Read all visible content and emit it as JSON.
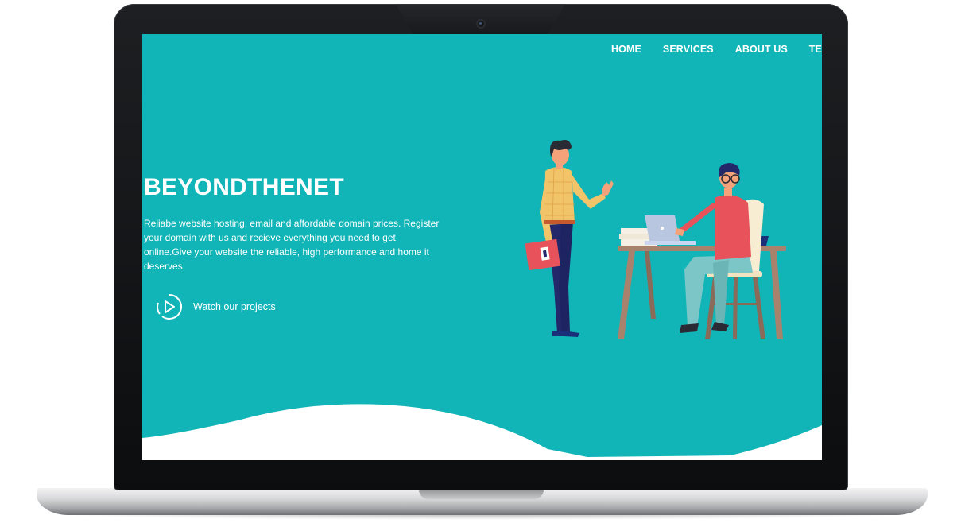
{
  "nav": {
    "items": [
      {
        "label": "HOME"
      },
      {
        "label": "SERVICES"
      },
      {
        "label": "ABOUT US"
      },
      {
        "label": "TESTIM"
      }
    ]
  },
  "hero": {
    "title": "BEYONDTHENET",
    "description": "Reliabe website hosting, email and affordable domain prices. Register your domain with us and recieve everything you need to get online.Give your website the reliable, high performance and home it deserves.",
    "cta_label": "Watch our projects",
    "cta_icon": "play-circle-icon"
  },
  "colors": {
    "hero_background": "#12b5b7",
    "text": "#ffffff",
    "wave": "#ffffff"
  }
}
